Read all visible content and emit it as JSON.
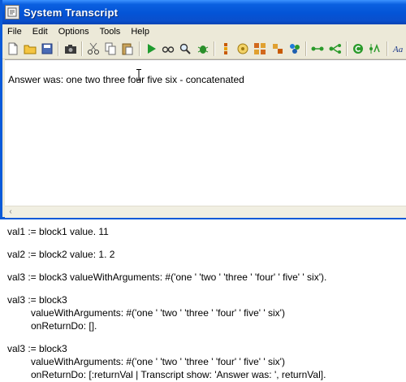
{
  "window": {
    "title": "System Transcript"
  },
  "menu": [
    "File",
    "Edit",
    "Options",
    "Tools",
    "Help"
  ],
  "toolbar": [
    "new-doc-icon",
    "open-folder-icon",
    "save-icon",
    "camera-icon",
    "cut-icon",
    "copy-icon",
    "paste-icon",
    "run-icon",
    "inspect-glasses-icon",
    "find-icon",
    "debug-bug-icon",
    "hierarchy-icon",
    "browser-icon",
    "class-icon",
    "instances-icon",
    "refresh-icon",
    "senders-icon",
    "implementors-icon",
    "recompile-icon",
    "format-icon",
    "font-icon"
  ],
  "transcript": {
    "output": "Answer was: one two three four five six - concatenated"
  },
  "code": [
    "val1 := block1 value. 11",
    "",
    "val2 := block2 value: 1. 2",
    "",
    "val3 := block3 valueWithArguments: #('one ' 'two ' 'three ' 'four' ' five' ' six').",
    "",
    "val3 := block3",
    "valueWithArguments: #('one ' 'two ' 'three ' 'four' ' five' ' six')",
    "onReturnDo: [].",
    "",
    "val3 := block3",
    "valueWithArguments: #('one ' 'two ' 'three ' 'four' ' five' ' six')",
    "onReturnDo: [:returnVal | Transcript show: 'Answer was: ', returnVal]."
  ],
  "colors": {
    "titlebar": "#0454d6",
    "chrome": "#ece9d8",
    "frame": "#0a5ad8"
  }
}
